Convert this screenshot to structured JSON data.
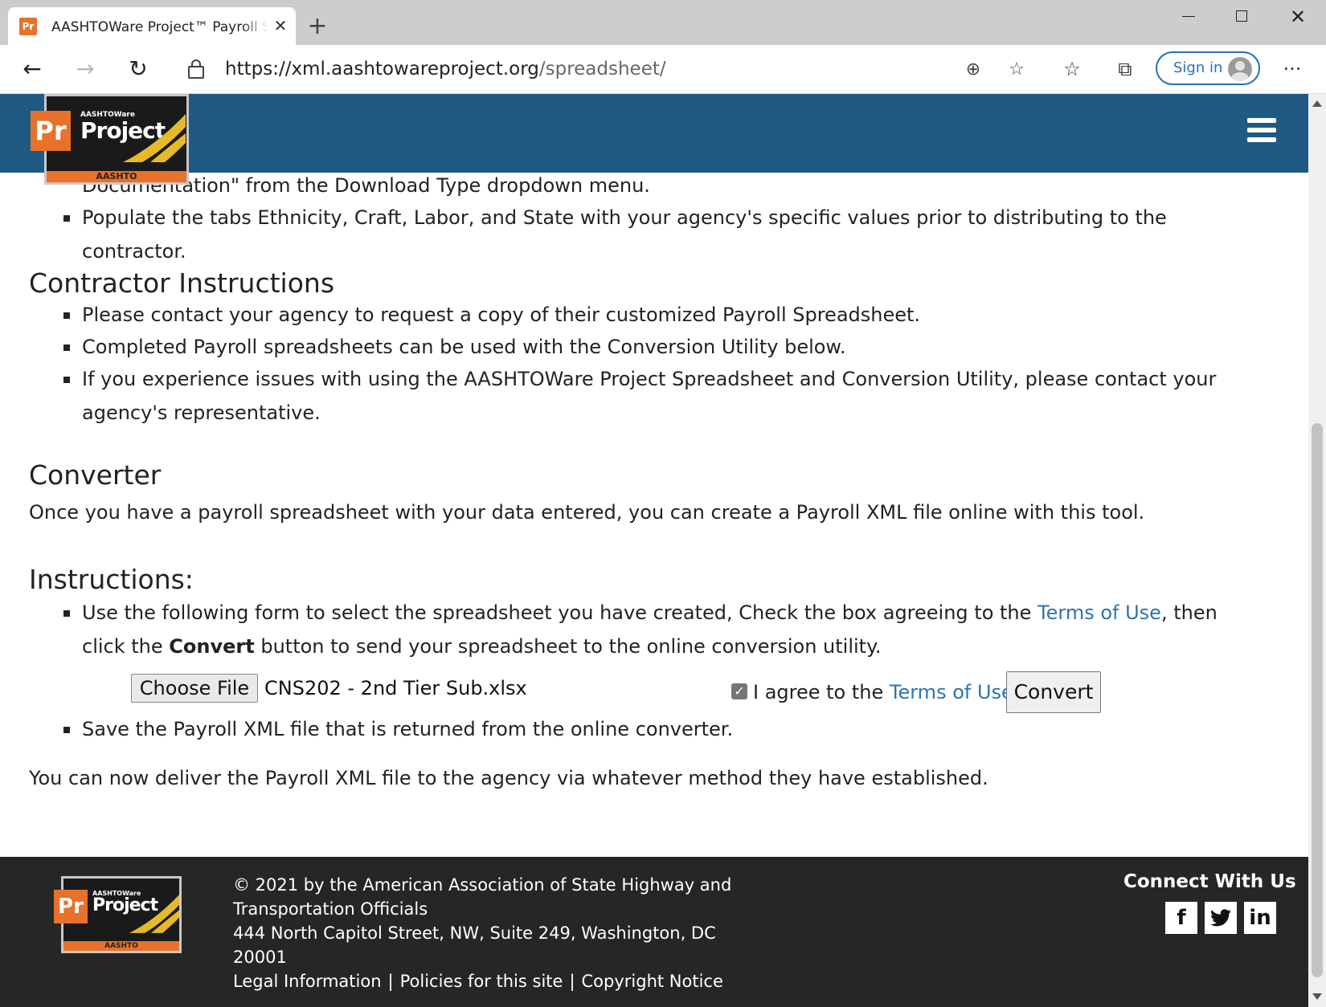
{
  "browser": {
    "tab_title": "AASHTOWare Project™ Payroll Spreadsheet",
    "tab_favicon": "Pr",
    "url_host": "https://xml.aashtowareproject.org",
    "url_path": "/spreadsheet/",
    "signin_label": "Sign in",
    "icons": [
      "back-icon",
      "forward-icon",
      "reload-icon",
      "lock-icon",
      "zoom-icon",
      "add-favorite-icon",
      "favorites-icon",
      "collections-icon",
      "avatar",
      "more-icon"
    ]
  },
  "header": {
    "logo": {
      "small": "AASHTOWare",
      "big": "Project",
      "pr": "Pr",
      "band": "AASHTO"
    },
    "menu_icon": "hamburger-icon",
    "color": "#1f5a85"
  },
  "content": {
    "partial_line": "Documentation\" from the Download Type dropdown menu.",
    "populate_bullet": "Populate the tabs Ethnicity, Craft, Labor, and State with your agency's specific values prior to distributing to the contractor.",
    "contractor": {
      "heading": "Contractor Instructions",
      "bullets": [
        "Please contact your agency to request a copy of their customized Payroll Spreadsheet.",
        "Completed Payroll spreadsheets can be used with the Conversion Utility below.",
        "If you experience issues with using the AASHTOWare Project Spreadsheet and Conversion Utility, please contact your agency's representative."
      ]
    },
    "converter": {
      "heading": "Converter",
      "text": "Once you have a payroll spreadsheet with your data entered, you can create a Payroll XML file online with this tool."
    },
    "instructions": {
      "heading": "Instructions:",
      "b1_pre": "Use the following form to select the spreadsheet you have created, Check the box agreeing to the ",
      "b1_link": "Terms of Use",
      "b1_mid": ", then click the ",
      "b1_bold": "Convert",
      "b1_post": " button to send your spreadsheet to the online conversion utility.",
      "b2": "Save the Payroll XML file that is returned from the online converter."
    },
    "form": {
      "choose_file_label": "Choose File",
      "file_name": "CNS202 - 2nd Tier Sub.xlsx",
      "agree_checked": true,
      "agree_text": "I agree to the ",
      "agree_link": "Terms of Use",
      "convert_label": "Convert"
    },
    "closing": "You can now deliver the Payroll XML file to the agency via whatever method they have established.",
    "link_color": "#2f73ad"
  },
  "footer": {
    "copyright_1": "© 2021 by the American Association of State Highway and",
    "copyright_2": "Transportation Officials",
    "address_1": "444 North Capitol Street, NW, Suite 249, Washington, DC",
    "address_2": "20001",
    "links": [
      "Legal Information",
      "Policies for this site",
      "Copyright Notice"
    ],
    "separator": "|",
    "connect": "Connect With Us",
    "social": [
      {
        "name": "facebook-icon",
        "glyph": "f"
      },
      {
        "name": "twitter-icon",
        "glyph": "🐦"
      },
      {
        "name": "linkedin-icon",
        "glyph": "in"
      }
    ],
    "color": "#262626"
  }
}
